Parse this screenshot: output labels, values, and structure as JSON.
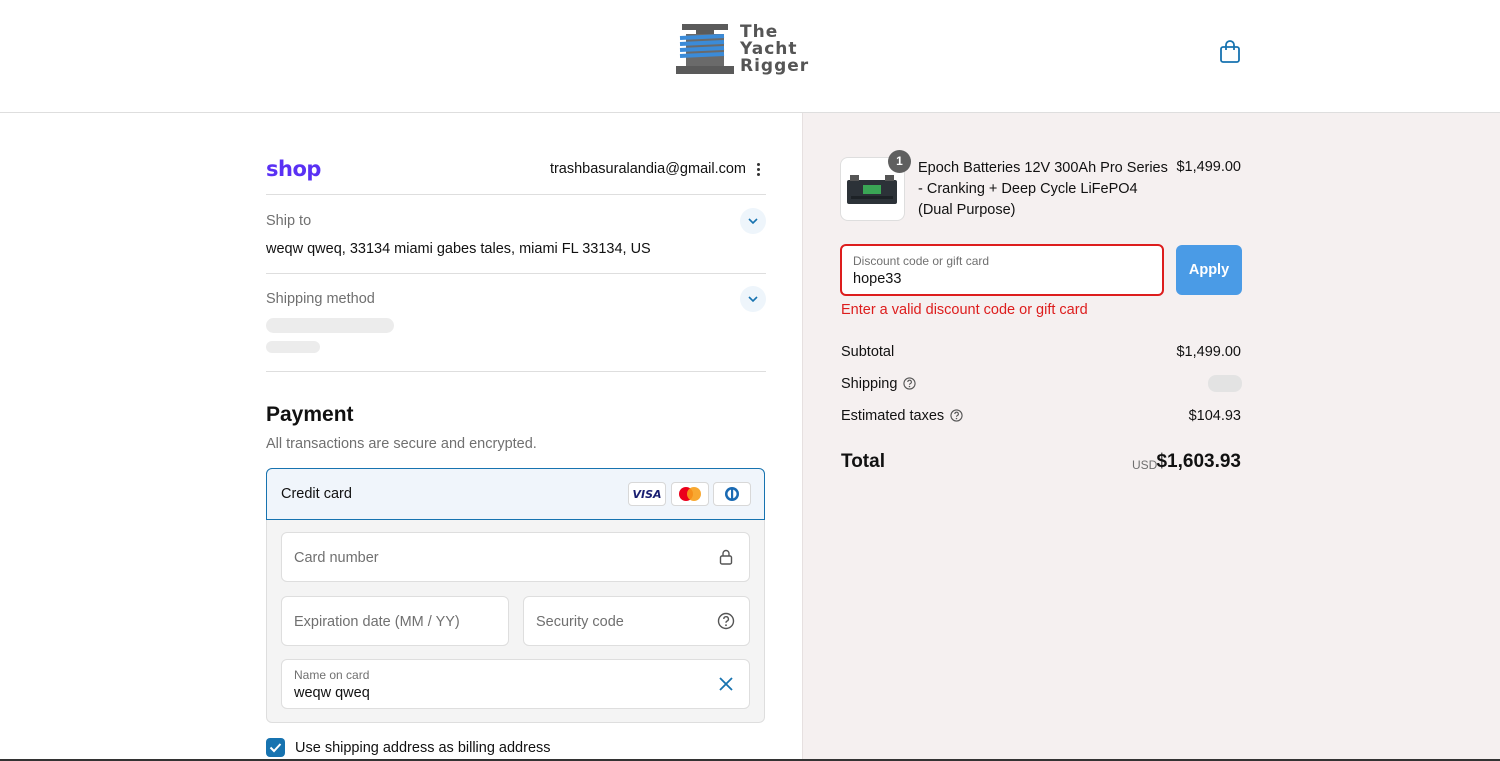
{
  "header": {
    "logo_lines": [
      "The",
      "Yacht",
      "Rigger"
    ],
    "cart_icon": "shopping-bag-icon"
  },
  "account": {
    "shop_brand": "shop",
    "email": "trashbasuralandia@gmail.com"
  },
  "ship_to": {
    "label": "Ship to",
    "value": "weqw qweq, 33134 miami gabes tales, miami FL 33134, US"
  },
  "shipping_method": {
    "label": "Shipping method"
  },
  "payment": {
    "title": "Payment",
    "subtitle": "All transactions are secure and encrypted.",
    "method_label": "Credit card",
    "brands": [
      "VISA",
      "mastercard",
      "diners"
    ],
    "card_number_placeholder": "Card number",
    "expiration_placeholder": "Expiration date (MM / YY)",
    "security_placeholder": "Security code",
    "name_label": "Name on card",
    "name_value": "weqw qweq",
    "billing_label": "Use shipping address as billing address",
    "billing_checked": true
  },
  "order": {
    "quantity": "1",
    "product_name": "Epoch Batteries 12V 300Ah Pro Series - Cranking + Deep Cycle LiFePO4 (Dual Purpose)",
    "product_price": "$1,499.00",
    "discount_label": "Discount code or gift card",
    "discount_value": "hope33",
    "apply_label": "Apply",
    "discount_error": "Enter a valid discount code or gift card",
    "subtotal_label": "Subtotal",
    "subtotal_value": "$1,499.00",
    "shipping_label": "Shipping",
    "taxes_label": "Estimated taxes",
    "taxes_value": "$104.93",
    "total_label": "Total",
    "currency": "USD",
    "total_value": "$1,603.93"
  },
  "colors": {
    "accent": "#1773b0",
    "apply_button": "#4a9be6",
    "error": "#dd1d1d",
    "shop_purple": "#5a31f4",
    "summary_bg": "#f5f0f0"
  }
}
